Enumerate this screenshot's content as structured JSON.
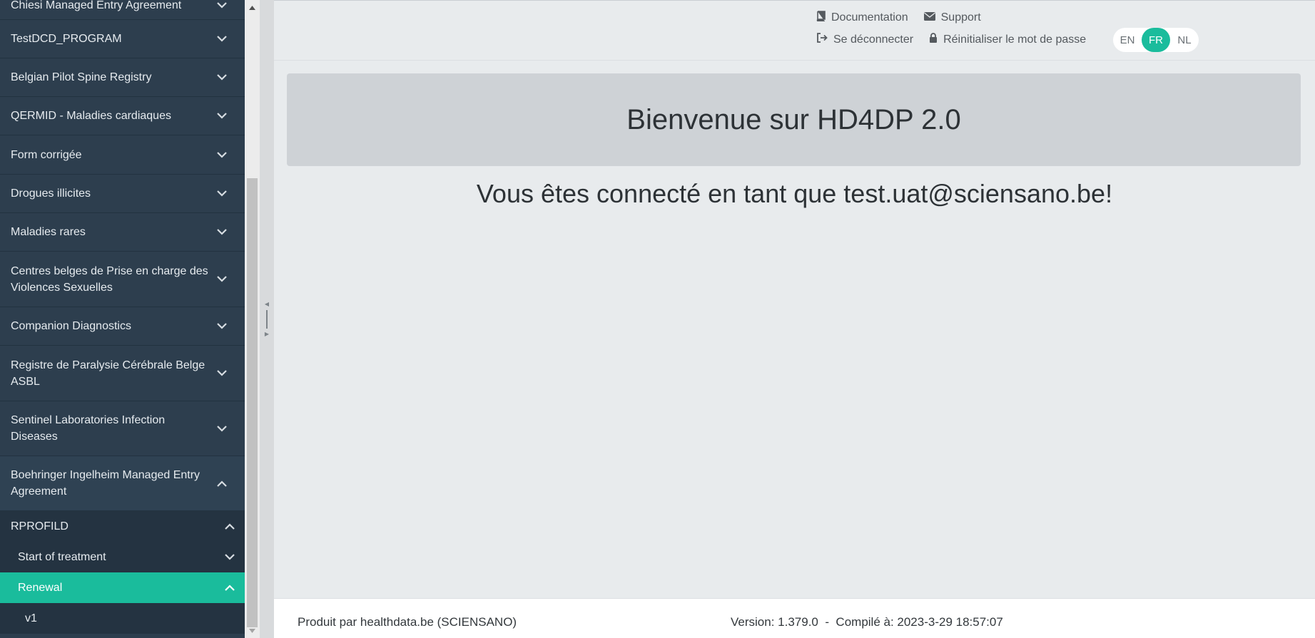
{
  "sidebar": {
    "items": [
      {
        "label": "Chiesi Managed Entry Agreement"
      },
      {
        "label": "TestDCD_PROGRAM"
      },
      {
        "label": "Belgian Pilot Spine Registry"
      },
      {
        "label": "QERMID - Maladies cardiaques"
      },
      {
        "label": "Form corrigée"
      },
      {
        "label": "Drogues illicites"
      },
      {
        "label": "Maladies rares"
      },
      {
        "label": "Centres belges de Prise en charge des Violences Sexuelles"
      },
      {
        "label": "Companion Diagnostics"
      },
      {
        "label": "Registre de Paralysie Cérébrale Belge ASBL"
      },
      {
        "label": "Sentinel Laboratories Infection Diseases"
      },
      {
        "label": "Boehringer Ingelheim Managed Entry Agreement"
      }
    ],
    "sub": {
      "program": "RPROFILD",
      "start": "Start of treatment",
      "renewal": "Renewal",
      "version": "v1"
    }
  },
  "topbar": {
    "documentation": "Documentation",
    "support": "Support",
    "logout": "Se déconnecter",
    "reset_password": "Réinitialiser le mot de passe",
    "languages": [
      "EN",
      "FR",
      "NL"
    ],
    "active_language": "FR"
  },
  "main": {
    "title": "Bienvenue sur HD4DP 2.0",
    "welcome_prefix": "Vous êtes connecté en tant que ",
    "email": "test.uat@sciensano.be",
    "welcome_suffix": "!"
  },
  "footer": {
    "producer": "Produit par healthdata.be (SCIENSANO)",
    "build": "Version: 1.379.0  -  Compilé à: 2023-3-29 18:57:07"
  },
  "colors": {
    "sidebar_bg": "#2d3e4e",
    "accent": "#1abc9c",
    "main_bg": "#e8ebed"
  }
}
